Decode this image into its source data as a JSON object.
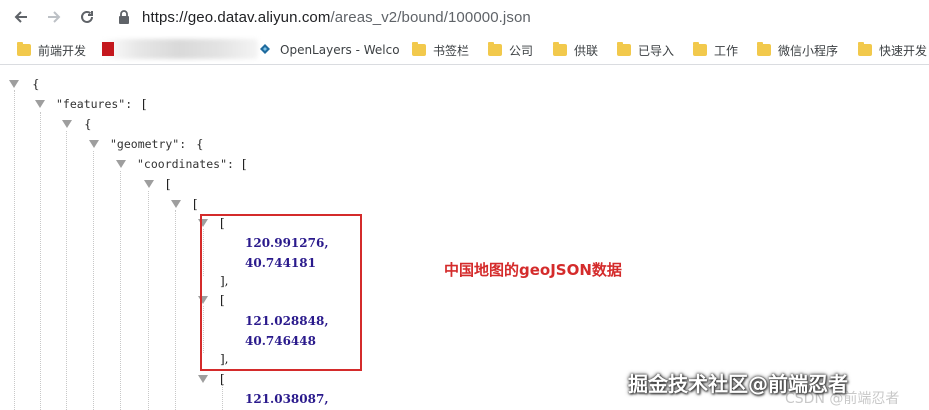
{
  "browser": {
    "url_host": "https://geo.datav.aliyun.com",
    "url_path": "/areas_v2/bound/100000.json",
    "bookmarks": [
      {
        "label": "前端开发",
        "icon": "folder-icon"
      },
      {
        "label": "OpenLayers - Welco",
        "icon": "openlayers-icon"
      },
      {
        "label": "书签栏",
        "icon": "folder-icon"
      },
      {
        "label": "公司",
        "icon": "folder-icon"
      },
      {
        "label": "供联",
        "icon": "folder-icon"
      },
      {
        "label": "已导入",
        "icon": "folder-icon"
      },
      {
        "label": "工作",
        "icon": "folder-icon"
      },
      {
        "label": "微信小程序",
        "icon": "folder-icon"
      },
      {
        "label": "快速开发",
        "icon": "folder-icon"
      }
    ]
  },
  "json_view": {
    "open_brace": "{",
    "open_bracket": "[",
    "close_bracket_comma": "],",
    "features_key": "\"features\":",
    "geometry_key": "\"geometry\":",
    "coordinates_key": "\"coordinates\":",
    "points": [
      {
        "lng": "120.991276,",
        "lat": "40.744181"
      },
      {
        "lng": "121.028848,",
        "lat": "40.746448"
      },
      {
        "lng": "121.038087,"
      }
    ]
  },
  "annotation": "中国地图的geoJSON数据",
  "watermark": "掘金技术社区@前端忍者",
  "watermark_faint": "CSDN @前端忍者",
  "colors": {
    "annotation": "#d42b2b",
    "numbers": "#2a1a8c"
  }
}
